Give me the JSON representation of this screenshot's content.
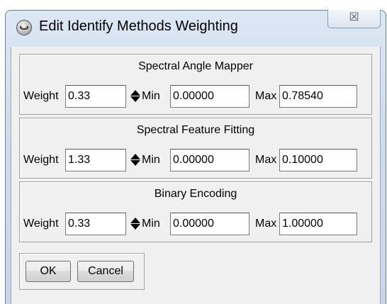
{
  "window": {
    "title": "Edit Identify Methods Weighting",
    "close_glyph": "☒",
    "icon": "app-globe-icon"
  },
  "groups": [
    {
      "title": "Spectral Angle Mapper",
      "weight_label": "Weight",
      "weight_value": "0.33",
      "min_label": "Min",
      "min_value": "0.00000",
      "max_label": "Max",
      "max_value": "0.78540"
    },
    {
      "title": "Spectral Feature Fitting",
      "weight_label": "Weight",
      "weight_value": "1.33",
      "min_label": "Min",
      "min_value": "0.00000",
      "max_label": "Max",
      "max_value": "0.10000"
    },
    {
      "title": "Binary Encoding",
      "weight_label": "Weight",
      "weight_value": "0.33",
      "min_label": "Min",
      "min_value": "0.00000",
      "max_label": "Max",
      "max_value": "1.00000"
    }
  ],
  "buttons": {
    "ok_label": "OK",
    "cancel_label": "Cancel"
  },
  "colors": {
    "frame": "#cfdcee",
    "client": "#f0f0f0"
  }
}
